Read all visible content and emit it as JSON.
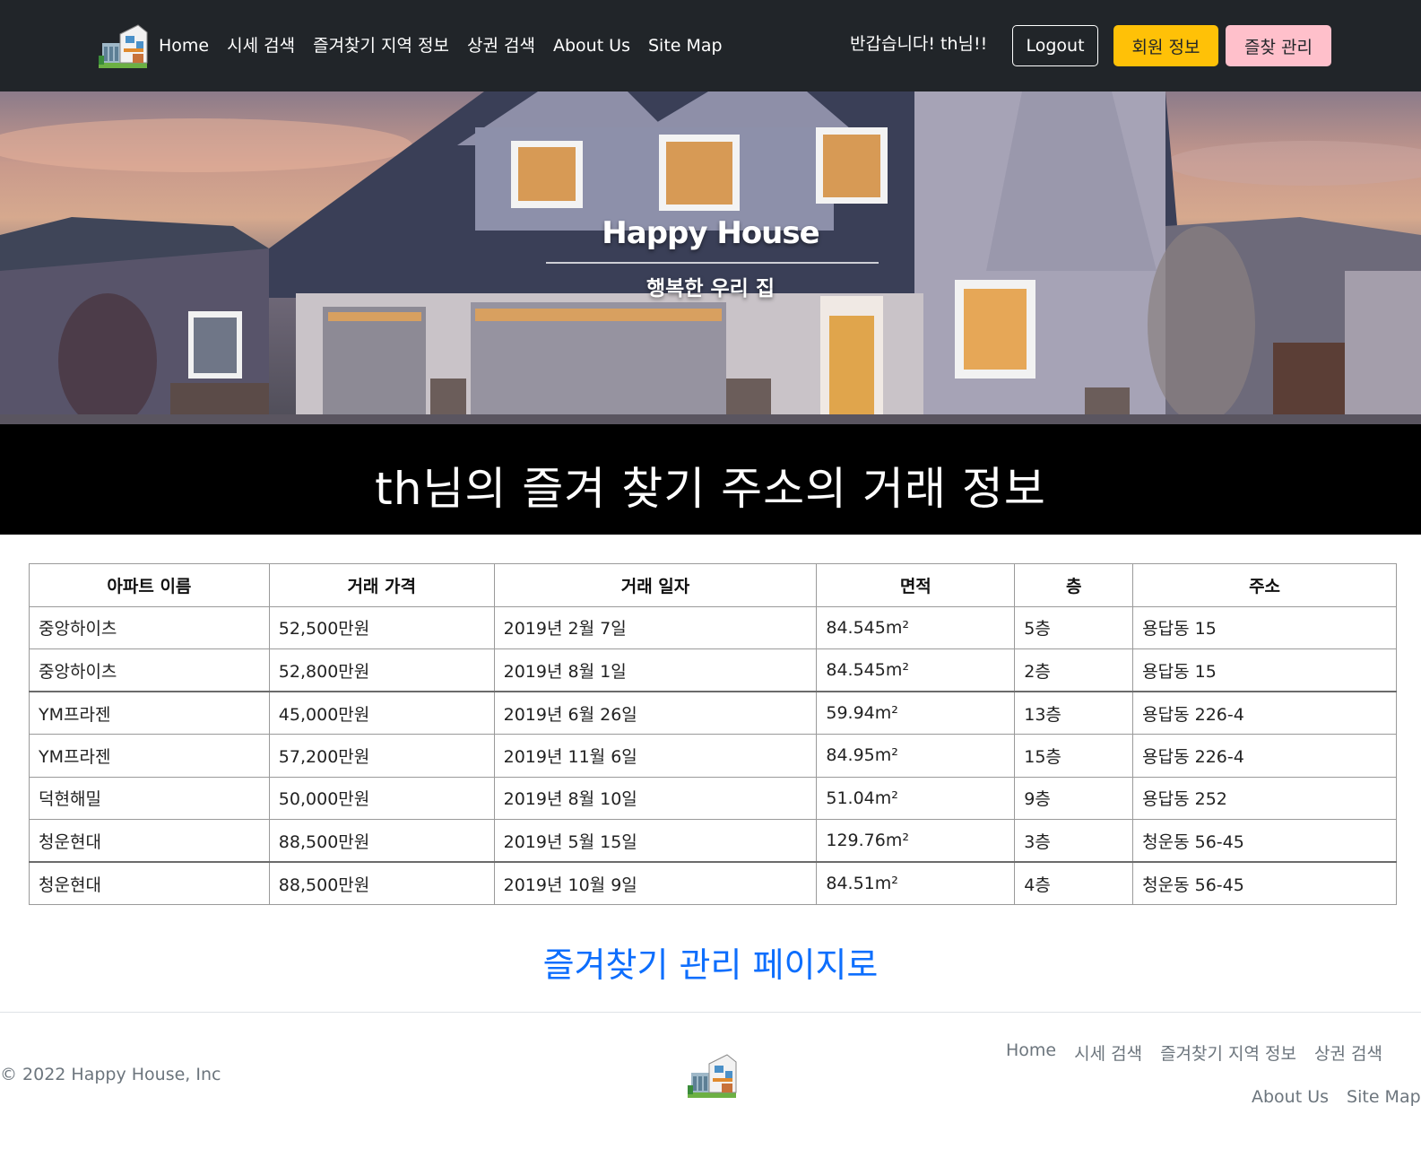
{
  "nav": {
    "links": [
      "Home",
      "시세 검색",
      "즐겨찾기 지역 정보",
      "상권 검색",
      "About Us",
      "Site Map"
    ],
    "greeting": "반갑습니다! th님!!",
    "logout": "Logout",
    "member_info": "회원 정보",
    "fav_manage": "즐찾 관리"
  },
  "hero": {
    "title": "Happy House",
    "subtitle": "행복한 우리 집"
  },
  "section_title": "th님의 즐겨 찾기 주소의 거래 정보",
  "table": {
    "headers": [
      "아파트 이름",
      "거래 가격",
      "거래 일자",
      "면적",
      "층",
      "주소"
    ],
    "rows": [
      [
        "중앙하이츠",
        "52,500만원",
        "2019년 2월 7일",
        "84.545m²",
        "5층",
        "용답동 15"
      ],
      [
        "중앙하이츠",
        "52,800만원",
        "2019년 8월 1일",
        "84.545m²",
        "2층",
        "용답동 15"
      ],
      [
        "YM프라젠",
        "45,000만원",
        "2019년 6월 26일",
        "59.94m²",
        "13층",
        "용답동 226-4"
      ],
      [
        "YM프라젠",
        "57,200만원",
        "2019년 11월 6일",
        "84.95m²",
        "15층",
        "용답동 226-4"
      ],
      [
        "덕현해밀",
        "50,000만원",
        "2019년 8월 10일",
        "51.04m²",
        "9층",
        "용답동 252"
      ],
      [
        "청운현대",
        "88,500만원",
        "2019년 5월 15일",
        "129.76m²",
        "3층",
        "청운동 56-45"
      ],
      [
        "청운현대",
        "88,500만원",
        "2019년 10월 9일",
        "84.51m²",
        "4층",
        "청운동 56-45"
      ]
    ]
  },
  "manage_link": "즐겨찾기 관리 페이지로",
  "footer": {
    "copyright": "© 2022 Happy House, Inc",
    "links_row1": [
      "Home",
      "시세 검색",
      "즐겨찾기 지역 정보",
      "상권 검색"
    ],
    "links_row2": [
      "About Us",
      "Site Map"
    ]
  },
  "colors": {
    "navbar_bg": "#212529",
    "member_btn": "#ffc107",
    "fav_btn": "#ffc0cb",
    "link": "#0d6efd"
  }
}
